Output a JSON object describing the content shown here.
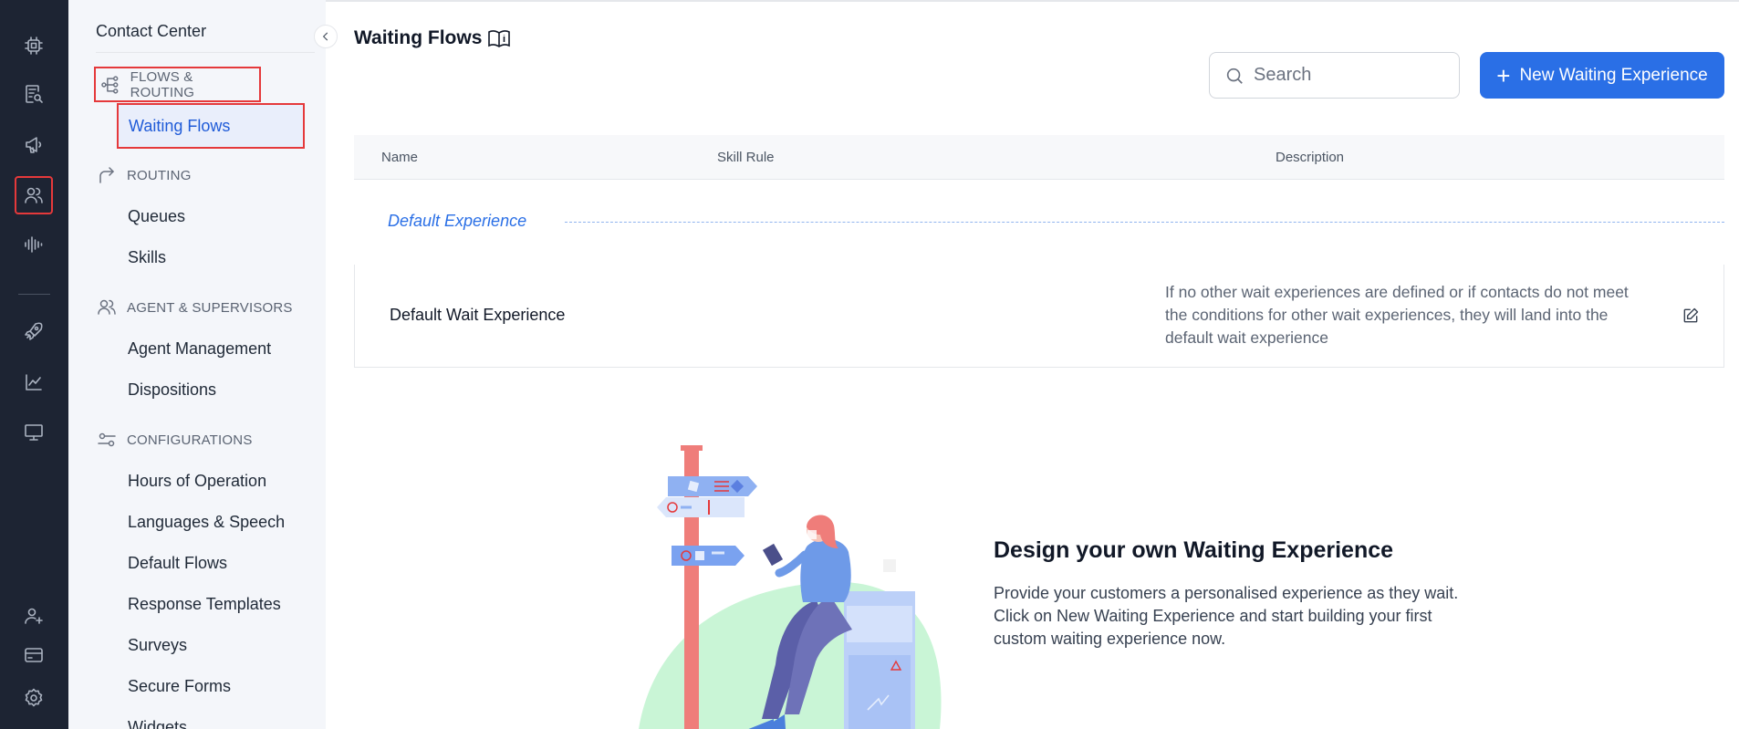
{
  "rail": {
    "icons": [
      "chip-icon",
      "report-search-icon",
      "megaphone-icon",
      "users-icon",
      "waveform-icon",
      "rocket-icon",
      "analytics-icon",
      "monitor-icon",
      "add-user-icon",
      "billing-card-icon",
      "settings-gear-icon"
    ],
    "active": "users-icon"
  },
  "sidebar": {
    "title": "Contact Center",
    "sections": [
      {
        "key": "flows",
        "label": "FLOWS & ROUTING",
        "icon": "flow-tree-icon",
        "items": [
          "Waiting Flows"
        ]
      },
      {
        "key": "routing",
        "label": "ROUTING",
        "icon": "redirect-arrow-icon",
        "items": [
          "Queues",
          "Skills"
        ]
      },
      {
        "key": "agents",
        "label": "AGENT & SUPERVISORS",
        "icon": "agents-icon",
        "items": [
          "Agent Management",
          "Dispositions"
        ]
      },
      {
        "key": "config",
        "label": "CONFIGURATIONS",
        "icon": "toggles-icon",
        "items": [
          "Hours of Operation",
          "Languages & Speech",
          "Default Flows",
          "Response Templates",
          "Surveys",
          "Secure Forms",
          "Widgets"
        ]
      }
    ],
    "active_item": "Waiting Flows"
  },
  "header": {
    "title": "Waiting Flows",
    "title_icon": "book-info-icon",
    "search_placeholder": "Search",
    "new_button_label": "New Waiting Experience"
  },
  "table": {
    "columns": [
      "Name",
      "Skill Rule",
      "Description"
    ],
    "group_label": "Default Experience",
    "rows": [
      {
        "name": "Default Wait Experience",
        "skill_rule": "",
        "description": "If no other wait experiences are defined or if contacts do not meet the conditions for other wait experiences, they will land into the default wait experience"
      }
    ]
  },
  "empty_state": {
    "title": "Design your own Waiting Experience",
    "text": "Provide your customers a personalised experience as they wait. Click on New Waiting Experience and start building your first custom waiting experience now."
  },
  "colors": {
    "rail_bg": "#1d2433",
    "sidebar_bg": "#f4f6fa",
    "accent": "#2a6fe6",
    "highlight_box": "#e5393b"
  }
}
